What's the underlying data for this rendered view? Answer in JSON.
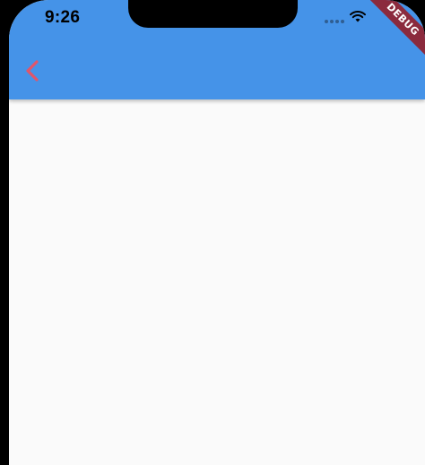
{
  "status_bar": {
    "time": "9:26",
    "icons": [
      "signal-dots-icon",
      "wifi-icon"
    ]
  },
  "app_bar": {
    "background_color": "#4593e8",
    "back_icon": "chevron-left-icon",
    "back_icon_color": "#e0566a"
  },
  "debug_banner": {
    "label": "DEBUG",
    "color": "#8b2a3d"
  },
  "content": {
    "background_color": "#fafafa"
  }
}
